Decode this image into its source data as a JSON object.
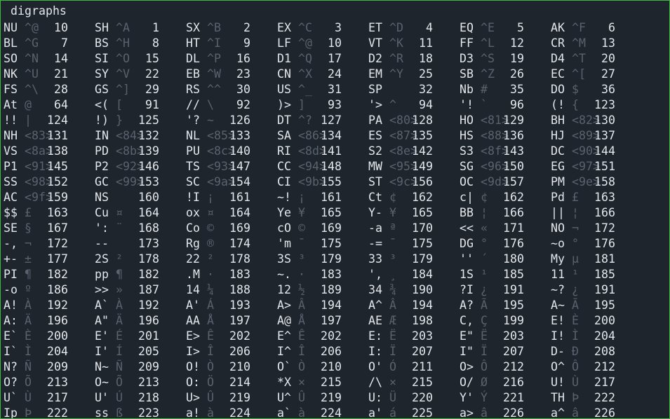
{
  "title": "digraphs",
  "rows": [
    [
      [
        "NU",
        "^@",
        "10"
      ],
      [
        "SH",
        "^A",
        "1"
      ],
      [
        "SX",
        "^B",
        "2"
      ],
      [
        "EX",
        "^C",
        "3"
      ],
      [
        "ET",
        "^D",
        "4"
      ],
      [
        "EQ",
        "^E",
        "5"
      ],
      [
        "AK",
        "^F",
        "6"
      ]
    ],
    [
      [
        "BL",
        "^G",
        "7"
      ],
      [
        "BS",
        "^H",
        "8"
      ],
      [
        "HT",
        "^I",
        "9"
      ],
      [
        "LF",
        "^@",
        "10"
      ],
      [
        "VT",
        "^K",
        "11"
      ],
      [
        "FF",
        "^L",
        "12"
      ],
      [
        "CR",
        "^M",
        "13"
      ]
    ],
    [
      [
        "SO",
        "^N",
        "14"
      ],
      [
        "SI",
        "^O",
        "15"
      ],
      [
        "DL",
        "^P",
        "16"
      ],
      [
        "D1",
        "^Q",
        "17"
      ],
      [
        "D2",
        "^R",
        "18"
      ],
      [
        "D3",
        "^S",
        "19"
      ],
      [
        "D4",
        "^T",
        "20"
      ]
    ],
    [
      [
        "NK",
        "^U",
        "21"
      ],
      [
        "SY",
        "^V",
        "22"
      ],
      [
        "EB",
        "^W",
        "23"
      ],
      [
        "CN",
        "^X",
        "24"
      ],
      [
        "EM",
        "^Y",
        "25"
      ],
      [
        "SB",
        "^Z",
        "26"
      ],
      [
        "EC",
        "^[",
        "27"
      ]
    ],
    [
      [
        "FS",
        "^\\",
        "28"
      ],
      [
        "GS",
        "^]",
        "29"
      ],
      [
        "RS",
        "^^",
        "30"
      ],
      [
        "US",
        "^_",
        "31"
      ],
      [
        "SP",
        "",
        "32"
      ],
      [
        "Nb",
        "#",
        "35"
      ],
      [
        "DO",
        "$",
        "36"
      ]
    ],
    [
      [
        "At",
        "@",
        "64"
      ],
      [
        "<(",
        "[",
        "91"
      ],
      [
        "//",
        "\\",
        "92"
      ],
      [
        ")>",
        "]",
        "93"
      ],
      [
        "'>",
        "^",
        "94"
      ],
      [
        "'!",
        "`",
        "96"
      ],
      [
        "(!",
        "{",
        "123"
      ]
    ],
    [
      [
        "!!",
        "|",
        "124"
      ],
      [
        "!)",
        "}",
        "125"
      ],
      [
        "'?",
        "~",
        "126"
      ],
      [
        "DT",
        "^?",
        "127"
      ],
      [
        "PA",
        "<80>",
        "128"
      ],
      [
        "HO",
        "<81>",
        "129"
      ],
      [
        "BH",
        "<82>",
        "130"
      ]
    ],
    [
      [
        "NH",
        "<83>",
        "131"
      ],
      [
        "IN",
        "<84>",
        "132"
      ],
      [
        "NL",
        "<85>",
        "133"
      ],
      [
        "SA",
        "<86>",
        "134"
      ],
      [
        "ES",
        "<87>",
        "135"
      ],
      [
        "HS",
        "<88>",
        "136"
      ],
      [
        "HJ",
        "<89>",
        "137"
      ]
    ],
    [
      [
        "VS",
        "<8a>",
        "138"
      ],
      [
        "PD",
        "<8b>",
        "139"
      ],
      [
        "PU",
        "<8c>",
        "140"
      ],
      [
        "RI",
        "<8d>",
        "141"
      ],
      [
        "S2",
        "<8e>",
        "142"
      ],
      [
        "S3",
        "<8f>",
        "143"
      ],
      [
        "DC",
        "<90>",
        "144"
      ]
    ],
    [
      [
        "P1",
        "<91>",
        "145"
      ],
      [
        "P2",
        "<92>",
        "146"
      ],
      [
        "TS",
        "<93>",
        "147"
      ],
      [
        "CC",
        "<94>",
        "148"
      ],
      [
        "MW",
        "<95>",
        "149"
      ],
      [
        "SG",
        "<96>",
        "150"
      ],
      [
        "EG",
        "<97>",
        "151"
      ]
    ],
    [
      [
        "SS",
        "<98>",
        "152"
      ],
      [
        "GC",
        "<99>",
        "153"
      ],
      [
        "SC",
        "<9a>",
        "154"
      ],
      [
        "CI",
        "<9b>",
        "155"
      ],
      [
        "ST",
        "<9c>",
        "156"
      ],
      [
        "OC",
        "<9d>",
        "157"
      ],
      [
        "PM",
        "<9e>",
        "158"
      ]
    ],
    [
      [
        "AC",
        "<9f>",
        "159"
      ],
      [
        "NS",
        "",
        "160"
      ],
      [
        "!I",
        "¡",
        "161"
      ],
      [
        "~!",
        "¡",
        "161"
      ],
      [
        "Ct",
        "¢",
        "162"
      ],
      [
        "c|",
        "¢",
        "162"
      ],
      [
        "Pd",
        "£",
        "163"
      ]
    ],
    [
      [
        "$$",
        "£",
        "163"
      ],
      [
        "Cu",
        "¤",
        "164"
      ],
      [
        "ox",
        "¤",
        "164"
      ],
      [
        "Ye",
        "¥",
        "165"
      ],
      [
        "Y-",
        "¥",
        "165"
      ],
      [
        "BB",
        "¦",
        "166"
      ],
      [
        "||",
        "¦",
        "166"
      ]
    ],
    [
      [
        "SE",
        "§",
        "167"
      ],
      [
        "':",
        "¨",
        "168"
      ],
      [
        "Co",
        "©",
        "169"
      ],
      [
        "cO",
        "©",
        "169"
      ],
      [
        "-a",
        "ª",
        "170"
      ],
      [
        "<<",
        "«",
        "171"
      ],
      [
        "NO",
        "¬",
        "172"
      ]
    ],
    [
      [
        "-,",
        "¬",
        "172"
      ],
      [
        "--",
        "",
        "173"
      ],
      [
        "Rg",
        "®",
        "174"
      ],
      [
        "'m",
        "¯",
        "175"
      ],
      [
        "-=",
        "¯",
        "175"
      ],
      [
        "DG",
        "°",
        "176"
      ],
      [
        "~o",
        "°",
        "176"
      ]
    ],
    [
      [
        "+-",
        "±",
        "177"
      ],
      [
        "2S",
        "²",
        "178"
      ],
      [
        "22",
        "²",
        "178"
      ],
      [
        "3S",
        "³",
        "179"
      ],
      [
        "33",
        "³",
        "179"
      ],
      [
        "''",
        "´",
        "180"
      ],
      [
        "My",
        "µ",
        "181"
      ]
    ],
    [
      [
        "PI",
        "¶",
        "182"
      ],
      [
        "pp",
        "¶",
        "182"
      ],
      [
        ".M",
        "·",
        "183"
      ],
      [
        "~.",
        "·",
        "183"
      ],
      [
        "',",
        "¸",
        "184"
      ],
      [
        "1S",
        "¹",
        "185"
      ],
      [
        "11",
        "¹",
        "185"
      ]
    ],
    [
      [
        "-o",
        "º",
        "186"
      ],
      [
        ">>",
        "»",
        "187"
      ],
      [
        "14",
        "¼",
        "188"
      ],
      [
        "12",
        "½",
        "189"
      ],
      [
        "34",
        "¾",
        "190"
      ],
      [
        "?I",
        "¿",
        "191"
      ],
      [
        "~?",
        "¿",
        "191"
      ]
    ],
    [
      [
        "A!",
        "À",
        "192"
      ],
      [
        "A`",
        "À",
        "192"
      ],
      [
        "A'",
        "Á",
        "193"
      ],
      [
        "A>",
        "Â",
        "194"
      ],
      [
        "A^",
        "Â",
        "194"
      ],
      [
        "A?",
        "Ã",
        "195"
      ],
      [
        "A~",
        "Ã",
        "195"
      ]
    ],
    [
      [
        "A:",
        "Ä",
        "196"
      ],
      [
        "A\"",
        "Ä",
        "196"
      ],
      [
        "AA",
        "Å",
        "197"
      ],
      [
        "A@",
        "Å",
        "197"
      ],
      [
        "AE",
        "Æ",
        "198"
      ],
      [
        "C,",
        "Ç",
        "199"
      ],
      [
        "E!",
        "È",
        "200"
      ]
    ],
    [
      [
        "E`",
        "È",
        "200"
      ],
      [
        "E'",
        "É",
        "201"
      ],
      [
        "E>",
        "Ê",
        "202"
      ],
      [
        "E^",
        "Ê",
        "202"
      ],
      [
        "E:",
        "Ë",
        "203"
      ],
      [
        "E\"",
        "Ë",
        "203"
      ],
      [
        "I!",
        "Ì",
        "204"
      ]
    ],
    [
      [
        "I`",
        "Ì",
        "204"
      ],
      [
        "I'",
        "Í",
        "205"
      ],
      [
        "I>",
        "Î",
        "206"
      ],
      [
        "I^",
        "Î",
        "206"
      ],
      [
        "I:",
        "Ï",
        "207"
      ],
      [
        "I\"",
        "Ï",
        "207"
      ],
      [
        "D-",
        "Đ",
        "208"
      ]
    ],
    [
      [
        "N?",
        "Ñ",
        "209"
      ],
      [
        "N~",
        "Ñ",
        "209"
      ],
      [
        "O!",
        "Ò",
        "210"
      ],
      [
        "O`",
        "Ò",
        "210"
      ],
      [
        "O'",
        "Ó",
        "211"
      ],
      [
        "O>",
        "Ô",
        "212"
      ],
      [
        "O^",
        "Ô",
        "212"
      ]
    ],
    [
      [
        "O?",
        "Õ",
        "213"
      ],
      [
        "O~",
        "Õ",
        "213"
      ],
      [
        "O:",
        "Ö",
        "214"
      ],
      [
        "*X",
        "×",
        "215"
      ],
      [
        "/\\",
        "×",
        "215"
      ],
      [
        "O/",
        "Ø",
        "216"
      ],
      [
        "U!",
        "Ù",
        "217"
      ]
    ],
    [
      [
        "U`",
        "Ù",
        "217"
      ],
      [
        "U'",
        "Ú",
        "218"
      ],
      [
        "U>",
        "Û",
        "219"
      ],
      [
        "U^",
        "Û",
        "219"
      ],
      [
        "U:",
        "Ü",
        "220"
      ],
      [
        "Y'",
        "Ý",
        "221"
      ],
      [
        "TH",
        "Þ",
        "222"
      ]
    ],
    [
      [
        "Ip",
        "Þ",
        "222"
      ],
      [
        "ss",
        "ß",
        "223"
      ],
      [
        "a!",
        "à",
        "224"
      ],
      [
        "a`",
        "à",
        "224"
      ],
      [
        "a'",
        "á",
        "225"
      ],
      [
        "a>",
        "â",
        "226"
      ],
      [
        "a^",
        "â",
        "226"
      ]
    ]
  ]
}
